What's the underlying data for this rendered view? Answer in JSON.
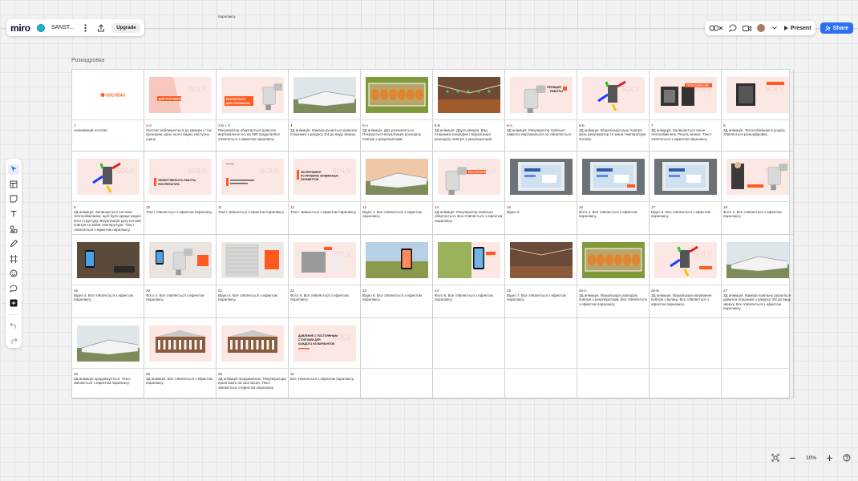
{
  "app": {
    "logo": "miro",
    "board_name": "SANST...",
    "upgrade_label": "Upgrade",
    "present_label": "Present",
    "share_label": "Share",
    "zoom_level": "10%",
    "accent": "#2b6ff5",
    "top_strip_text": "паралаксу."
  },
  "frame": {
    "title": "Розкадровка"
  },
  "cells": [
    {
      "num": "1",
      "text": "Анімований логотип",
      "thumb": "logo"
    },
    {
      "num": "2-А",
      "text": "Логотип наближається до камери і стає прозорим, крізь нього видно наступну сцену",
      "thumb": "pinkSlide"
    },
    {
      "num": "2-Б + 3",
      "text": "Рекуператор обертається довкола вертикальної осі на 360 градусів Все з'являється з ефектом паралаксу.",
      "thumb": "pinkDevice"
    },
    {
      "num": "4",
      "text": "3Д анімація. Камера рухається довкола пташника з ракурсу 3/4 до виду зверху.",
      "thumb": "barn"
    },
    {
      "num": "5-А",
      "text": "3Д анімація. Дах розчиняється. Показується візуалізація розподілу повітря з рекуператорів.",
      "thumb": "roofTop"
    },
    {
      "num": "5-Б",
      "text": "3Д анімація. Друга камера. Вид пташника всередині і візуалізація розподілу повітря з рекуператорів.",
      "thumb": "interior"
    },
    {
      "num": "6-А",
      "text": "3Д анімація. Рекуператор повільно навколо вертикальної осі обертається.",
      "thumb": "pinkDevice2"
    },
    {
      "num": "6-Б",
      "text": "3Д анімація. Візуалізація руху повітря крізь рекуператор та зміни температури потоків.",
      "thumb": "arrows"
    },
    {
      "num": "7",
      "text": "3Д анімація. Залишається лише теплообмінник. Решта зникає. Текст з'являється з ефектом паралаксу.",
      "thumb": "exchanger"
    },
    {
      "num": "8",
      "text": "3Д анімація. Теплообмінник в розрізі. З'являється розшифровка.",
      "thumb": "exchanger2"
    },
    {
      "num": "9",
      "text": "3Д анімація. Залишається частина теплообмінника, щоб було краще видно його структуру. Візуалізація руху потоків повітря та зміни температури. Текст з'являється з ефектом паралаксу.",
      "thumb": "arrows2"
    },
    {
      "num": "10",
      "text": "Текст з'являється з ефектом паралаксу.",
      "thumb": "pinkText"
    },
    {
      "num": "11",
      "text": "Текст змінюється з ефектом паралаксу.",
      "thumb": "pinkText2"
    },
    {
      "num": "12",
      "text": "Текст змінюється з ефектом паралаксу.",
      "thumb": "pinkText3"
    },
    {
      "num": "13",
      "text": "Відео 1. Все з'являється з ефектом паралаксу.",
      "thumb": "barnSunset"
    },
    {
      "num": "14",
      "text": "3Д анімація. Рекуператор повільно обертається. Все з'являється з ефектом паралаксу.",
      "thumb": "pinkDevice3"
    },
    {
      "num": "15",
      "text": "Відео 2.",
      "thumb": "panel"
    },
    {
      "num": "16",
      "text": "Фото 2. Все з'являється з ефектом паралаксу.",
      "thumb": "panel2"
    },
    {
      "num": "17",
      "text": "Відео 2. Все з'являється з ефектом паралаксу.",
      "thumb": "panel3"
    },
    {
      "num": "18",
      "text": "Фото 3. Все з'являється з ефектом паралаксу.",
      "thumb": "pinkMan"
    },
    {
      "num": "19",
      "text": "Відео 4. Все з'являється з ефектом паралаксу.",
      "thumb": "phoneDark"
    },
    {
      "num": "20",
      "text": "Фото 4. Все з'являється з ефектом паралаксу.",
      "thumb": "phoneDevice"
    },
    {
      "num": "21",
      "text": "Відео 5. Все з'являється з ефектом паралаксу.",
      "thumb": "louvers"
    },
    {
      "num": "22",
      "text": "Фото 5. Все з'являється з ефектом паралаксу.",
      "thumb": "pinkUnit"
    },
    {
      "num": "23",
      "text": "Відео 6. Все з'являється з ефектом паралаксу.",
      "thumb": "fieldPhone"
    },
    {
      "num": "24",
      "text": "Фото 6. Все з'являється з ефектом паралаксу.",
      "thumb": "fieldPhone2"
    },
    {
      "num": "25",
      "text": "Відео 7. Все з'являється з ефектом паралаксу.",
      "thumb": "interior2"
    },
    {
      "num": "26-А",
      "text": "3Д анімація. Візуалізація розподілу повітря з рекуператорів. Все з'являється з ефектом паралаксу.",
      "thumb": "roofTop2"
    },
    {
      "num": "26-Б",
      "text": "3Д анімація. Візуалізація нагрівання повітря з вулиці. Все з'являється з ефектом паралаксу.",
      "thumb": "arrows3"
    },
    {
      "num": "27",
      "text": "3Д анімація. Камера повільно рухається довкола пташника з ракурсу 3/4 до виду зверху. Все з'являється з ефектом паралаксу.",
      "thumb": "barn2"
    },
    {
      "num": "28",
      "text": "3Д анімація продовжується. Текст змінюється з ефектом паралаксу.",
      "thumb": "barn3"
    },
    {
      "num": "29",
      "text": "3Д анімація. Все з'являється з ефектом паралаксу.",
      "thumb": "cutaway"
    },
    {
      "num": "30",
      "text": "3Д анімація продовження. Рекуператори прилітають на свої місця. Текст змінюється з ефектом паралаксу.",
      "thumb": "cutaway2"
    },
    {
      "num": "31",
      "text": "Все з'являється з ефектом паралаксу.",
      "thumb": "pinkEnd"
    }
  ],
  "thumb_text": {
    "logo": "SOLVENO",
    "pinkSlide": "ДЛЯ ПТИЧНИКОВ",
    "pinkDevice": "РЕКУПЕРАТОР ДЛЯ ПТИЧНИКОВ",
    "pinkDevice2": "ПРИНЦИП РАБОТЫ",
    "exchanger": "ТЕПЛООБМЕННИК",
    "pinkText": "ЭФФЕКТИВНОСТЬ РАБОТЫ РЕКУПЕРАТОРА",
    "pinkText3": "ЭКСПЕРИМЕНТ ПО ПРОВЕРКЕ ЗАЯВЛЕННЫХ ПАРАМЕТРОВ",
    "pinkDevice3": "РЕКУПЕРАТОРЫ",
    "pinkEnd": "ДАВЛЕНИЕ С ПОСТОЯННЫМ СТОЛПАМИ ДЛЯ КАЖДОГО ИЗ ВАРИАНТОВ"
  }
}
